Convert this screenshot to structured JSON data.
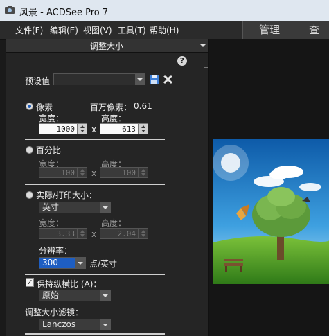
{
  "window": {
    "title": "风景 - ACDSee Pro 7"
  },
  "menu": [
    "文件(F)",
    "编辑(E)",
    "视图(V)",
    "工具(T)",
    "帮助(H)"
  ],
  "modes": [
    "管理",
    "查看"
  ],
  "panel": {
    "title": "调整大小",
    "help_label": "?",
    "preset_label": "预设值",
    "preset_value": "",
    "pixels": {
      "label": "像素",
      "megapixels_label": "百万像素：",
      "megapixels_value": "0.61",
      "width_label": "宽度：",
      "height_label": "高度：",
      "width_value": "1000",
      "height_value": "613",
      "times": "x"
    },
    "percent": {
      "label": "百分比",
      "width_label": "宽度：",
      "height_label": "高度：",
      "width_value": "100",
      "height_value": "100",
      "times": "x"
    },
    "actual": {
      "label": "实际/打印大小：",
      "unit_value": "英寸",
      "width_label": "宽度：",
      "height_label": "高度：",
      "width_value": "3.33",
      "height_value": "2.04",
      "times": "x",
      "resolution_label": "分辨率：",
      "resolution_value": "300",
      "resolution_unit": "点/英寸"
    },
    "aspect": {
      "label": "保持纵横比 (A)：",
      "checked": true,
      "value": "原始"
    },
    "filter": {
      "label": "调整大小滤镜：",
      "value": "Lanczos"
    }
  },
  "colors": {
    "accent": "#1d5bb7",
    "panel": "#252525",
    "titlebar": "#dfe7f0"
  }
}
